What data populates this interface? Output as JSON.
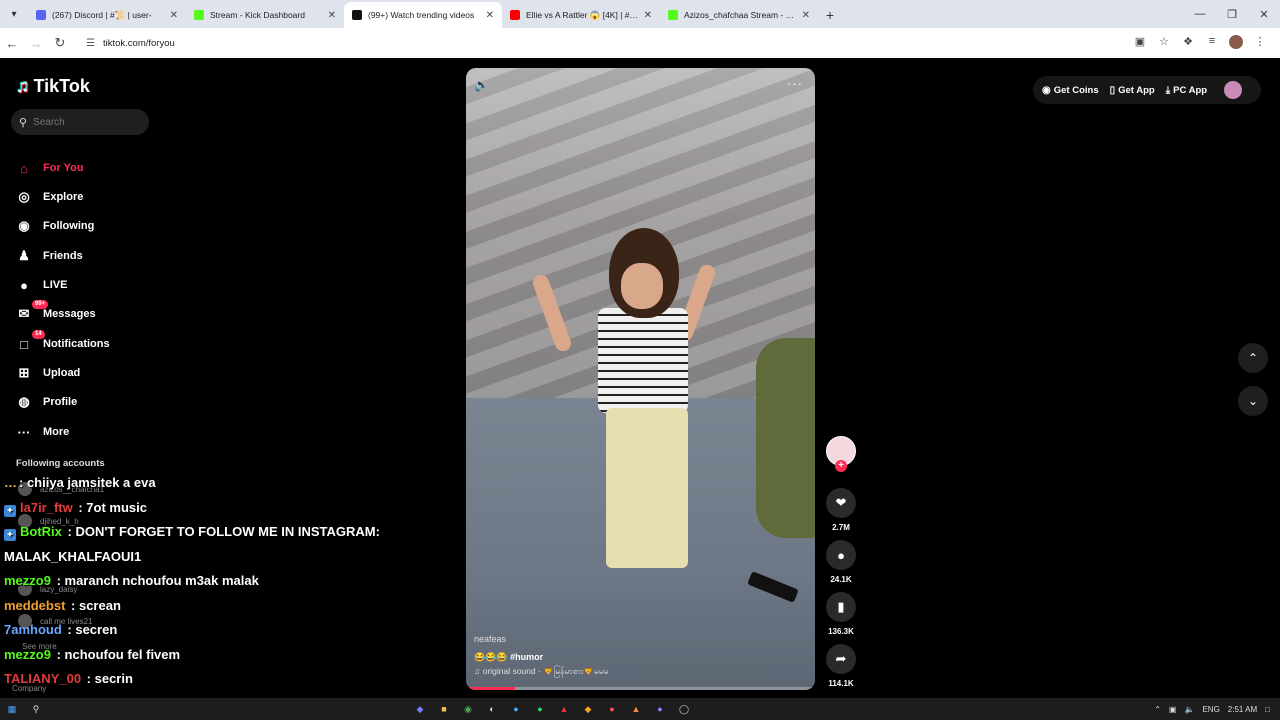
{
  "browser": {
    "tabs": [
      {
        "title": "(267) Discord | #📜 | user-",
        "fav": "#5865f2",
        "active": false
      },
      {
        "title": "Stream - Kick Dashboard",
        "fav": "#53fc18",
        "active": false
      },
      {
        "title": "(99+) Watch trending videos",
        "fav": "#111111",
        "active": true
      },
      {
        "title": "Ellie vs A Rattler 😱 [4K] | #sho",
        "fav": "#ff0000",
        "active": false
      },
      {
        "title": "Azizos_chafchaa Stream - Watc",
        "fav": "#53fc18",
        "active": false
      }
    ],
    "url": "tiktok.com/foryou"
  },
  "sidebar": {
    "logo": "TikTok",
    "search_placeholder": "Search",
    "nav": [
      {
        "label": "For You",
        "icon": "home-icon",
        "glyph": "⌂",
        "active": true
      },
      {
        "label": "Explore",
        "icon": "compass-icon",
        "glyph": "◎",
        "active": false
      },
      {
        "label": "Following",
        "icon": "following-icon",
        "glyph": "◉",
        "active": false
      },
      {
        "label": "Friends",
        "icon": "friends-icon",
        "glyph": "♟",
        "active": false
      },
      {
        "label": "LIVE",
        "icon": "live-icon",
        "glyph": "●",
        "active": false
      },
      {
        "label": "Messages",
        "icon": "messages-icon",
        "glyph": "✉",
        "badge": "99+",
        "active": false
      },
      {
        "label": "Notifications",
        "icon": "notifications-icon",
        "glyph": "□",
        "badge": "14",
        "active": false
      },
      {
        "label": "Upload",
        "icon": "upload-icon",
        "glyph": "⊞",
        "active": false
      },
      {
        "label": "Profile",
        "icon": "profile-icon",
        "glyph": "◍",
        "active": false
      },
      {
        "label": "More",
        "icon": "more-icon",
        "glyph": "···",
        "active": false
      }
    ],
    "following_title": "Following accounts",
    "following": [
      "azizos__chafcha1",
      "djihed_k_h",
      "lazy_daisy",
      "call me lives21"
    ],
    "see_more": "See more",
    "company": "Company"
  },
  "chat": [
    {
      "user": "…",
      "user_color": "#e8c04a",
      "msg": ": chiiya jamsitek a eva"
    },
    {
      "user": "la7ir_ftw",
      "user_color": "#e23b3b",
      "msg": " : 7ot music",
      "badge": true
    },
    {
      "user": "BotRix",
      "user_color": "#53fc18",
      "msg": " : DON'T FORGET TO FOLLOW ME IN INSTAGRAM:",
      "badge": true
    },
    {
      "user": "",
      "user_color": "#ffffff",
      "msg": "MALAK_KHALFAOUI1"
    },
    {
      "user": "mezzo9",
      "user_color": "#53fc18",
      "msg": " : maranch nchoufou m3ak malak"
    },
    {
      "user": "meddebst",
      "user_color": "#f0a030",
      "msg": " : screan"
    },
    {
      "user": "7amhoud",
      "user_color": "#6aa8ff",
      "msg": " : secren"
    },
    {
      "user": "mezzo9",
      "user_color": "#53fc18",
      "msg": " : nchoufou fel fivem"
    },
    {
      "user": "TALIANY_00",
      "user_color": "#e23b3b",
      "msg": " : secrin"
    },
    {
      "user": "la7ir_ftw",
      "user_color": "#e23b3b",
      "msg": " : screen",
      "badge": true
    }
  ],
  "video": {
    "author": "neafeas",
    "caption": "😂😂😂 #humor",
    "sound": "♫ original sound - 🦁မြန်မာစား🦁မမမ",
    "progress": 0.14
  },
  "actions": {
    "likes": "2.7M",
    "comments": "24.1K",
    "saves": "136.3K",
    "shares": "114.1K"
  },
  "top_right": {
    "get_coins": "Get Coins",
    "get_app": "Get App",
    "pc_app": "PC App"
  },
  "taskbar": {
    "lang": "ENG",
    "time": "2:51 AM"
  }
}
